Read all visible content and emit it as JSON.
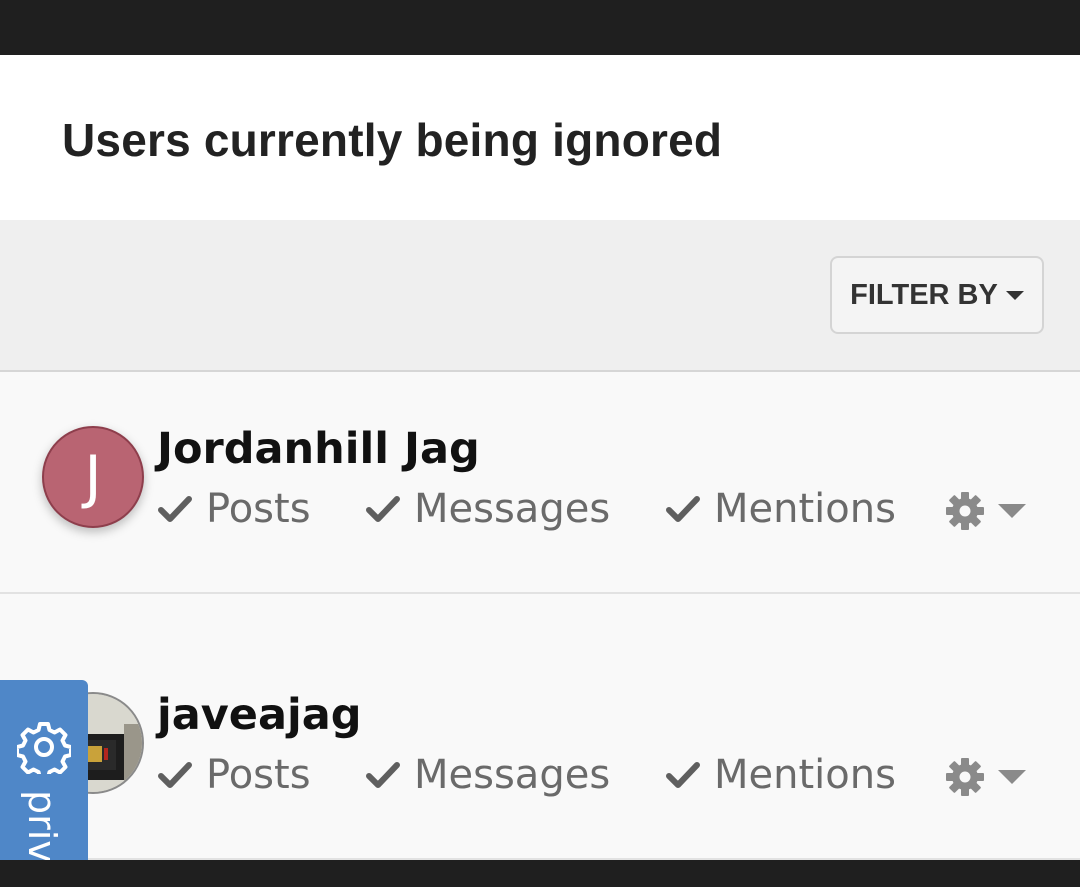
{
  "page": {
    "title": "Users currently being ignored"
  },
  "filter": {
    "label": "FILTER BY"
  },
  "users": [
    {
      "name": "Jordanhill Jag",
      "avatar_initial": "J",
      "avatar_color": "#b96472",
      "toggles": {
        "posts": "Posts",
        "messages": "Messages",
        "mentions": "Mentions"
      }
    },
    {
      "name": "javeajag",
      "avatar_initial": "",
      "toggles": {
        "posts": "Posts",
        "messages": "Messages",
        "mentions": "Mentions"
      }
    }
  ],
  "privacy": {
    "label": "priva"
  },
  "colors": {
    "accent": "#4f87c8",
    "toggle_text": "#6a6a6a"
  },
  "icons": {
    "check": "check-icon",
    "gear": "gear-icon",
    "caret": "caret-down-icon",
    "privacy": "settings-icon"
  }
}
